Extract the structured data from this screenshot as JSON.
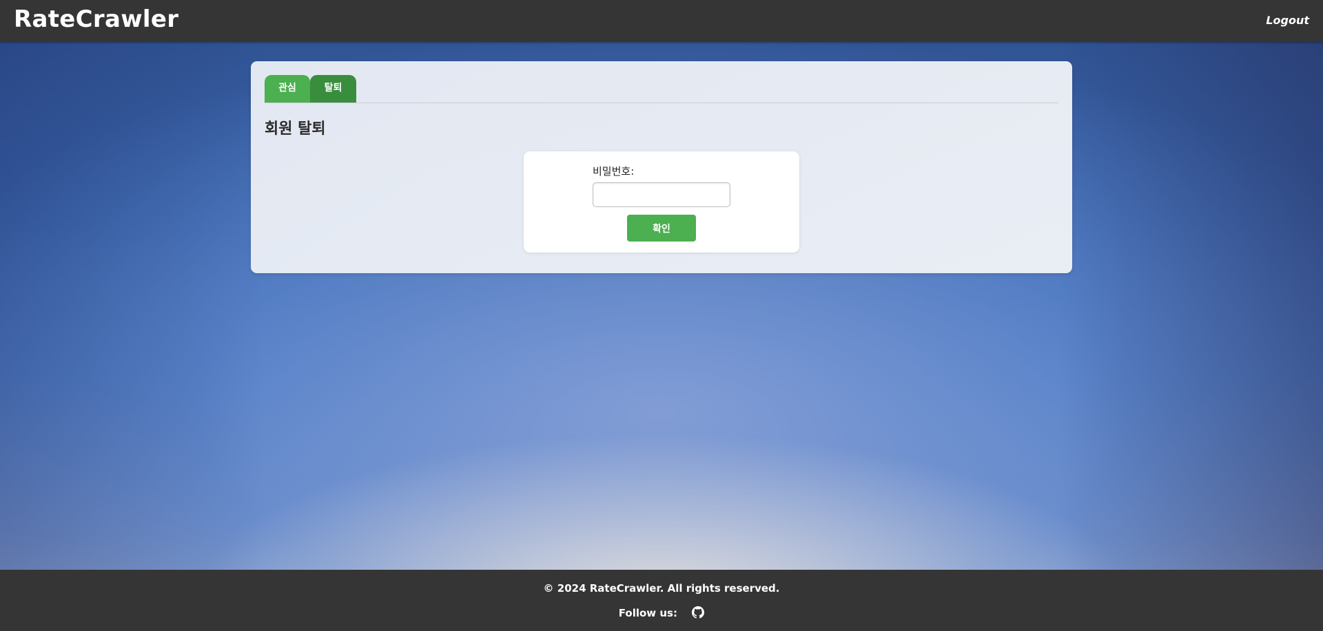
{
  "header": {
    "logo": "RateCrawler",
    "logout_label": "Logout"
  },
  "tabs": [
    {
      "label": "관심",
      "active": false
    },
    {
      "label": "탈퇴",
      "active": true
    }
  ],
  "main": {
    "title": "회원 탈퇴",
    "form": {
      "password_label": "비밀번호:",
      "password_value": "",
      "confirm_label": "확인"
    }
  },
  "footer": {
    "copyright": "© 2024 RateCrawler. All rights reserved.",
    "follow_label": "Follow us:",
    "social_icon": "github-icon"
  },
  "colors": {
    "header_bg": "#353535",
    "accent_green": "#4caf50",
    "active_tab_green": "#388e3c"
  }
}
